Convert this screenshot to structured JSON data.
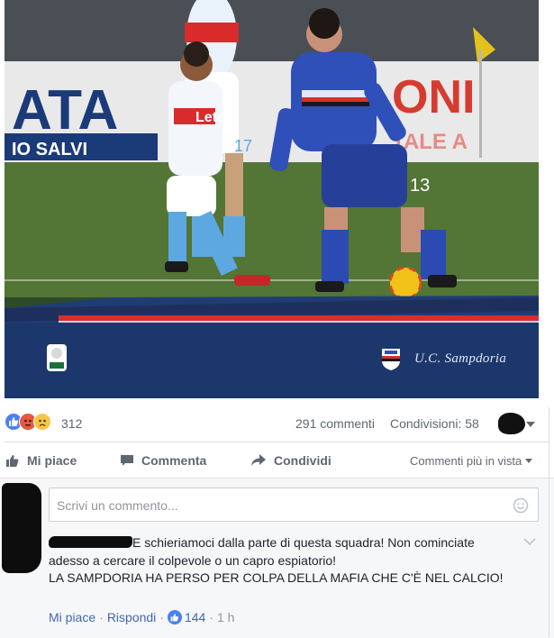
{
  "post": {
    "photo": {
      "watermark_text": "U.C. Sampdoria",
      "shirt_sponsor": "Lete",
      "shirt_number_left": "17",
      "shirt_number_right": "13",
      "board_text": "ATA"
    },
    "reactions": {
      "icons": [
        "like-icon",
        "angry-icon",
        "sad-icon"
      ],
      "count": "312"
    },
    "comments_count": "291 commenti",
    "shares_count": "Condivisioni: 58"
  },
  "actions": {
    "like": "Mi piace",
    "comment": "Commenta",
    "share": "Condividi",
    "sort": "Commenti più in vista"
  },
  "comment_box": {
    "placeholder": "Scrivi un commento..."
  },
  "comment": {
    "line1": "E schieriamoci dalla parte di questa squadra! Non cominciate adesso a cercare il colpevole o un capro espiatorio!",
    "line2": "LA SAMPDORIA HA PERSO PER COLPA DELLA MAFIA CHE C'È NEL CALCIO!",
    "like_label": "Mi piace",
    "reply_label": "Rispondi",
    "likes": "144",
    "time": "1 h"
  },
  "colors": {
    "like_blue": "#4a81f0",
    "link_blue": "#4267b2",
    "muted_text": "#616770"
  }
}
